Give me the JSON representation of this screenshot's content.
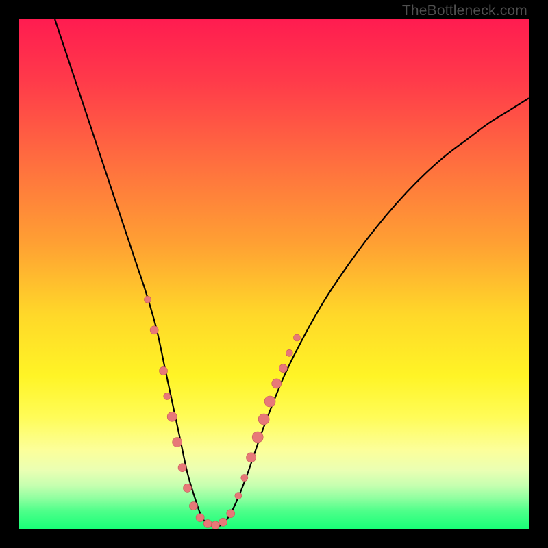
{
  "watermark": "TheBottleneck.com",
  "colors": {
    "frame": "#000000",
    "curve": "#000000",
    "dot_fill": "#e77878",
    "dot_stroke": "#c55858"
  },
  "chart_data": {
    "type": "line",
    "title": "",
    "xlabel": "",
    "ylabel": "",
    "xlim": [
      0,
      100
    ],
    "ylim": [
      0,
      100
    ],
    "gradient_stops": [
      {
        "offset": 0.0,
        "color": "#ff1c50"
      },
      {
        "offset": 0.12,
        "color": "#ff3a4a"
      },
      {
        "offset": 0.28,
        "color": "#ff6e3f"
      },
      {
        "offset": 0.44,
        "color": "#ffa033"
      },
      {
        "offset": 0.58,
        "color": "#ffd829"
      },
      {
        "offset": 0.7,
        "color": "#fff426"
      },
      {
        "offset": 0.78,
        "color": "#fffc57"
      },
      {
        "offset": 0.845,
        "color": "#fcff9a"
      },
      {
        "offset": 0.885,
        "color": "#eaffb3"
      },
      {
        "offset": 0.915,
        "color": "#c6ffb0"
      },
      {
        "offset": 0.94,
        "color": "#8fffa0"
      },
      {
        "offset": 0.965,
        "color": "#4eff8a"
      },
      {
        "offset": 1.0,
        "color": "#19ff77"
      }
    ],
    "series": [
      {
        "name": "bottleneck-curve",
        "x": [
          7,
          9,
          11,
          13,
          15,
          17,
          19,
          21,
          23,
          25,
          27,
          28.5,
          30,
          31.5,
          33,
          34.5,
          36,
          38,
          40,
          42,
          44.5,
          48,
          52,
          56,
          60,
          64,
          68,
          72,
          76,
          80,
          84,
          88,
          92,
          96,
          100
        ],
        "y": [
          100,
          94,
          88,
          82,
          76,
          70,
          64,
          58,
          52,
          46,
          39,
          32,
          25,
          18,
          11,
          6,
          2,
          0.5,
          1,
          4,
          10,
          20,
          30,
          38,
          45,
          51,
          56.5,
          61.5,
          66,
          70,
          73.5,
          76.5,
          79.5,
          82,
          84.5
        ]
      }
    ],
    "markers": [
      {
        "x": 25.2,
        "y": 45,
        "r": 5
      },
      {
        "x": 26.5,
        "y": 39,
        "r": 6
      },
      {
        "x": 28.3,
        "y": 31,
        "r": 6
      },
      {
        "x": 29.0,
        "y": 26,
        "r": 5
      },
      {
        "x": 30.0,
        "y": 22,
        "r": 7
      },
      {
        "x": 31.0,
        "y": 17,
        "r": 7
      },
      {
        "x": 32.0,
        "y": 12,
        "r": 6
      },
      {
        "x": 33.0,
        "y": 8,
        "r": 6
      },
      {
        "x": 34.2,
        "y": 4.5,
        "r": 6
      },
      {
        "x": 35.5,
        "y": 2.2,
        "r": 6
      },
      {
        "x": 37.0,
        "y": 1.0,
        "r": 6
      },
      {
        "x": 38.5,
        "y": 0.7,
        "r": 6
      },
      {
        "x": 40.0,
        "y": 1.3,
        "r": 6
      },
      {
        "x": 41.5,
        "y": 3.0,
        "r": 6
      },
      {
        "x": 43.0,
        "y": 6.5,
        "r": 5
      },
      {
        "x": 44.2,
        "y": 10,
        "r": 5
      },
      {
        "x": 45.5,
        "y": 14,
        "r": 7
      },
      {
        "x": 46.8,
        "y": 18,
        "r": 8
      },
      {
        "x": 48.0,
        "y": 21.5,
        "r": 8
      },
      {
        "x": 49.2,
        "y": 25,
        "r": 8
      },
      {
        "x": 50.5,
        "y": 28.5,
        "r": 7
      },
      {
        "x": 51.8,
        "y": 31.5,
        "r": 6
      },
      {
        "x": 53.0,
        "y": 34.5,
        "r": 5
      },
      {
        "x": 54.5,
        "y": 37.5,
        "r": 5
      }
    ]
  }
}
